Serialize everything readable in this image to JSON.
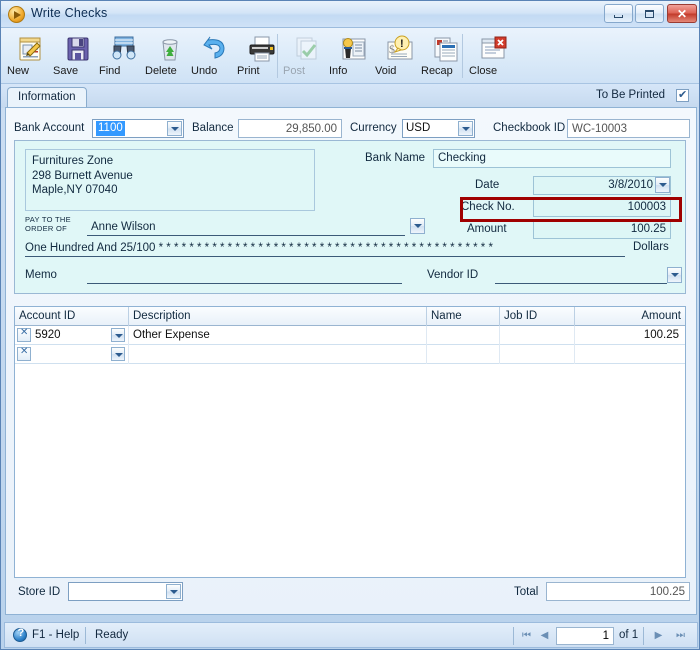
{
  "window": {
    "title": "Write Checks",
    "icon": "app-play-icon",
    "controls": {
      "minimize": "minimize-button",
      "maximize": "maximize-button",
      "close_glyph": "✕"
    }
  },
  "toolbar": {
    "buttons": [
      {
        "label": "New",
        "icon": "new-document-icon",
        "disabled": false
      },
      {
        "label": "Save",
        "icon": "floppy-disk-icon",
        "disabled": false
      },
      {
        "label": "Find",
        "icon": "binoculars-icon",
        "disabled": false
      },
      {
        "label": "Delete",
        "icon": "recycle-bin-icon",
        "disabled": false
      },
      {
        "label": "Undo",
        "icon": "undo-arrow-icon",
        "disabled": false
      },
      {
        "label": "Print",
        "icon": "printer-icon",
        "disabled": false
      },
      {
        "label": "Post",
        "icon": "post-checkmark-icon",
        "disabled": true
      },
      {
        "label": "Info",
        "icon": "info-person-icon",
        "disabled": false
      },
      {
        "label": "Void",
        "icon": "void-warning-icon",
        "disabled": false
      },
      {
        "label": "Recap",
        "icon": "recap-report-icon",
        "disabled": false
      },
      {
        "label": "Close",
        "icon": "close-window-icon",
        "disabled": false
      }
    ]
  },
  "tabs": {
    "items": [
      {
        "label": "Information",
        "active": true
      }
    ],
    "to_be_printed_label": "To Be Printed",
    "to_be_printed_checked": true
  },
  "form": {
    "bank_account_label": "Bank Account",
    "bank_account_value": "1100",
    "balance_label": "Balance",
    "balance_value": "29,850.00",
    "currency_label": "Currency",
    "currency_value": "USD",
    "checkbook_id_label": "Checkbook ID",
    "checkbook_id_value": "WC-10003"
  },
  "check": {
    "payer_name": "Furnitures Zone",
    "payer_street": "298 Burnett Avenue",
    "payer_citystatezip": "Maple,NY 07040",
    "pay_to_the_label": "PAY TO THE",
    "order_of_label": "ORDER OF",
    "payee": "Anne Wilson",
    "amount_words": "One Hundred  And 25/100 * * * * * * * * * * * * * * * * * * * * * * * * * * * * * * * * * * * * * * * * * * * *",
    "dollars_label": "Dollars",
    "memo_label": "Memo",
    "memo_value": "",
    "vendor_id_label": "Vendor ID",
    "vendor_id_value": "",
    "bank_name_label": "Bank Name",
    "bank_name_value": "Checking",
    "date_label": "Date",
    "date_value": "3/8/2010",
    "check_no_label": "Check No.",
    "check_no_value": "100003",
    "amount_label": "Amount",
    "amount_value": "100.25"
  },
  "annotation": {
    "highlight_color": "#a00000",
    "target": "check-no-field"
  },
  "grid": {
    "columns": [
      {
        "label": "Account ID",
        "align": "left"
      },
      {
        "label": "Description",
        "align": "left"
      },
      {
        "label": "Name",
        "align": "left"
      },
      {
        "label": "Job ID",
        "align": "left"
      },
      {
        "label": "Amount",
        "align": "right"
      }
    ],
    "rows": [
      {
        "account_id": "5920",
        "description": "Other Expense",
        "name": "",
        "job_id": "",
        "amount": "100.25"
      },
      {
        "account_id": "",
        "description": "",
        "name": "",
        "job_id": "",
        "amount": ""
      }
    ]
  },
  "footer": {
    "store_id_label": "Store ID",
    "store_id_value": "",
    "total_label": "Total",
    "total_value": "100.25"
  },
  "statusbar": {
    "help_label": "F1 - Help",
    "status_text": "Ready",
    "page_value": "1",
    "page_of_label": "of 1",
    "nav_first": "⏮",
    "nav_prev": "◀",
    "nav_next": "▶",
    "nav_last": "⏭"
  }
}
